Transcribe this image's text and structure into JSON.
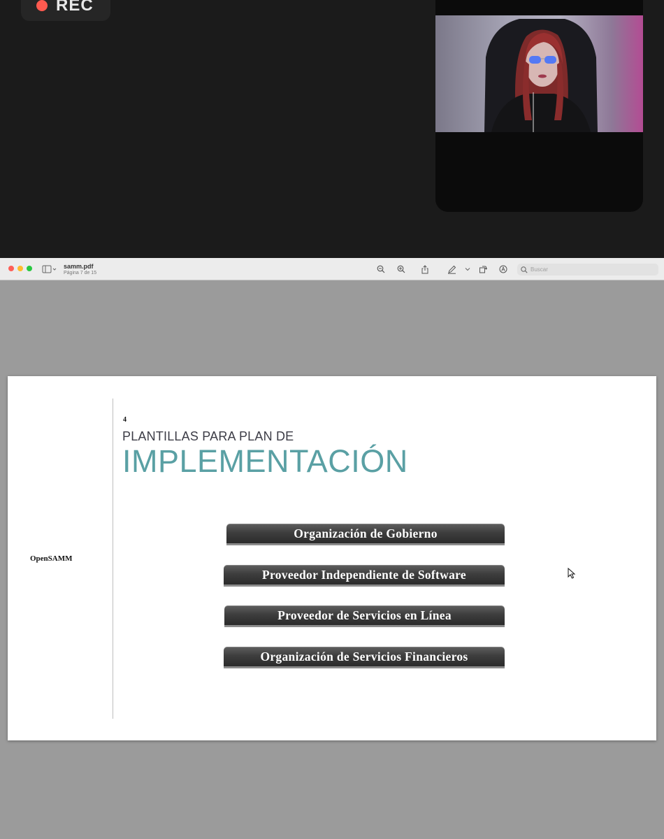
{
  "recording": {
    "label": "REC",
    "dot_color": "#ff5a4f"
  },
  "viewer": {
    "document_title": "samm.pdf",
    "page_indicator": "Página 7 de 15",
    "search_placeholder": "Buscar",
    "toolbar_icons": [
      "sidebar-icon",
      "zoom-out-icon",
      "zoom-in-icon",
      "share-icon",
      "markup-pen-icon",
      "rotate-icon",
      "annotate-icon",
      "search-icon"
    ]
  },
  "slide": {
    "sidebar_label": "OpenSAMM",
    "page_number": "4",
    "heading_small": "PLANTILLAS PARA PLAN DE",
    "heading_large": "IMPLEMENTACIÓN",
    "accent_color": "#5aa0a4",
    "buttons": [
      "Organización de Gobierno",
      "Proveedor Independiente de Software",
      "Proveedor de Servicios en Línea",
      "Organización de Servicios Financieros"
    ]
  }
}
